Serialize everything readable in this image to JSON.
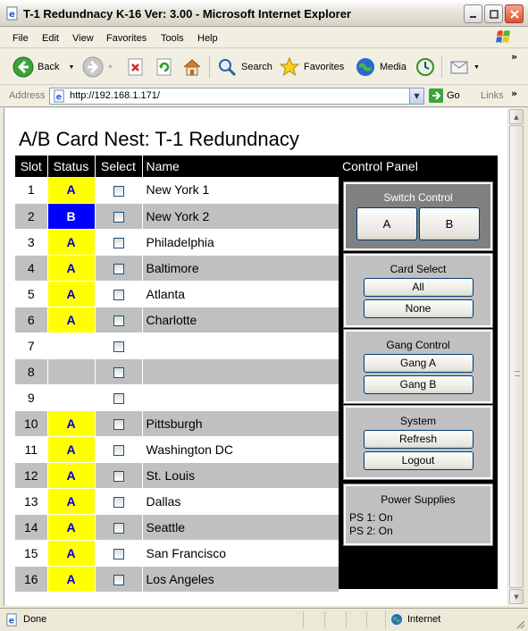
{
  "window": {
    "title": "T-1 Redundnacy K-16 Ver: 3.00 - Microsoft Internet Explorer"
  },
  "menu": [
    "File",
    "Edit",
    "View",
    "Favorites",
    "Tools",
    "Help"
  ],
  "toolbar": {
    "back": "Back",
    "search": "Search",
    "favorites": "Favorites",
    "media": "Media"
  },
  "address": {
    "label": "Address",
    "url": "http://192.168.1.171/",
    "go": "Go",
    "links": "Links"
  },
  "page": {
    "title": "A/B Card Nest: T-1 Redundnacy",
    "columns": [
      "Slot",
      "Status",
      "Select",
      "Name"
    ],
    "rows": [
      {
        "slot": "1",
        "status": "A",
        "name": "New York 1"
      },
      {
        "slot": "2",
        "status": "B",
        "name": "New York 2"
      },
      {
        "slot": "3",
        "status": "A",
        "name": "Philadelphia"
      },
      {
        "slot": "4",
        "status": "A",
        "name": "Baltimore"
      },
      {
        "slot": "5",
        "status": "A",
        "name": "Atlanta"
      },
      {
        "slot": "6",
        "status": "A",
        "name": "Charlotte"
      },
      {
        "slot": "7",
        "status": "",
        "name": ""
      },
      {
        "slot": "8",
        "status": "",
        "name": ""
      },
      {
        "slot": "9",
        "status": "",
        "name": ""
      },
      {
        "slot": "10",
        "status": "A",
        "name": "Pittsburgh"
      },
      {
        "slot": "11",
        "status": "A",
        "name": "Washington DC"
      },
      {
        "slot": "12",
        "status": "A",
        "name": "St. Louis"
      },
      {
        "slot": "13",
        "status": "A",
        "name": "Dallas"
      },
      {
        "slot": "14",
        "status": "A",
        "name": "Seattle"
      },
      {
        "slot": "15",
        "status": "A",
        "name": "San Francisco"
      },
      {
        "slot": "16",
        "status": "A",
        "name": "Los Angeles"
      }
    ]
  },
  "control_panel": {
    "title": "Control Panel",
    "switch_control": {
      "title": "Switch Control",
      "a": "A",
      "b": "B"
    },
    "card_select": {
      "title": "Card Select",
      "all": "All",
      "none": "None"
    },
    "gang_control": {
      "title": "Gang Control",
      "gang_a": "Gang A",
      "gang_b": "Gang B"
    },
    "system": {
      "title": "System",
      "refresh": "Refresh",
      "logout": "Logout"
    },
    "power": {
      "title": "Power Supplies",
      "ps1": "PS 1: On",
      "ps2": "PS 2: On"
    }
  },
  "statusbar": {
    "text": "Done",
    "zone": "Internet"
  },
  "colors": {
    "status_a_bg": "#ffff00",
    "status_a_fg": "#0000cc",
    "status_b_bg": "#0000ff",
    "header_bg": "#000000",
    "row_alt": "#c0c0c0"
  }
}
